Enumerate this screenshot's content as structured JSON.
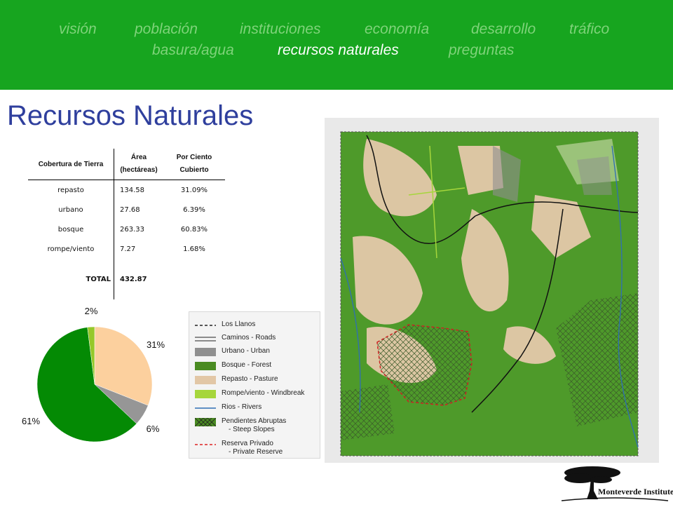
{
  "nav": {
    "items": [
      "visión",
      "población",
      "instituciones",
      "economía",
      "desarrollo",
      "tráfico",
      "basura/agua",
      "recursos naturales",
      "preguntas"
    ],
    "active_index": 7
  },
  "page": {
    "title": "Recursos Naturales"
  },
  "table": {
    "headers": [
      "Cobertura de Tierra",
      "Área (hectáreas)",
      "Por Ciento Cubierto"
    ],
    "rows": [
      [
        "repasto",
        "134.58",
        "31.09%"
      ],
      [
        "urbano",
        "27.68",
        "6.39%"
      ],
      [
        "bosque",
        "263.33",
        "60.83%"
      ],
      [
        "rompe/viento",
        "7.27",
        "1.68%"
      ]
    ],
    "total": [
      "TOTAL",
      "432.87"
    ]
  },
  "chart_data": {
    "type": "pie",
    "categories": [
      "repasto",
      "urbano",
      "bosque",
      "rompe/viento"
    ],
    "values": [
      31,
      6,
      61,
      2
    ],
    "labels": [
      "31%",
      "6%",
      "61%",
      "2%"
    ],
    "colors": [
      "#fcd09e",
      "#969696",
      "#048a04",
      "#95c82a"
    ]
  },
  "legend": {
    "items": [
      {
        "label": "Los Llanos",
        "swatch": "dashed-black"
      },
      {
        "label": "Caminos - Roads",
        "swatch": "road"
      },
      {
        "label": "Urbano - Urban",
        "swatch": "#8f8f8f"
      },
      {
        "label": "Bosque - Forest",
        "swatch": "#4a8b22"
      },
      {
        "label": "Repasto - Pasture",
        "swatch": "#e2c7a6"
      },
      {
        "label": "Rompe/viento - Windbreak",
        "swatch": "#a6d63c"
      },
      {
        "label": "Rios - Rivers",
        "swatch": "blue-line"
      },
      {
        "label": "Pendientes Abruptas",
        "sub": "- Steep Slopes",
        "swatch": "hatched"
      },
      {
        "label": "Reserva Privado",
        "sub": "- Private Reserve",
        "swatch": "dashed-red"
      }
    ]
  },
  "logo": {
    "text": "Monteverde Institute"
  }
}
